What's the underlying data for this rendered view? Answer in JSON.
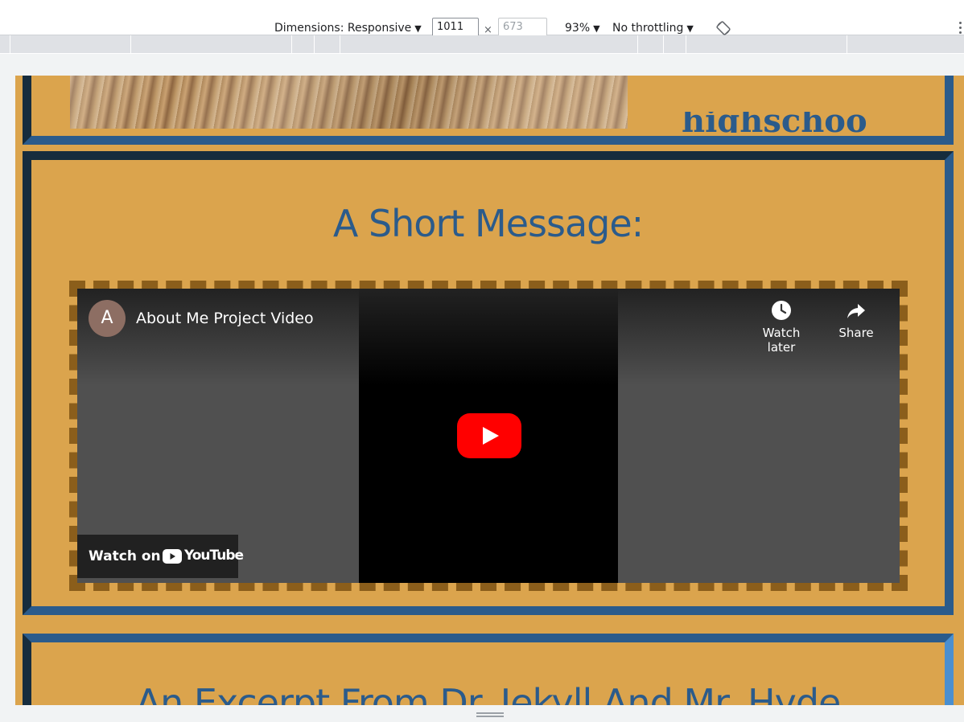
{
  "toolbar": {
    "dimensions_label": "Dimensions: Responsive",
    "width_value": "1011",
    "times": "×",
    "height_placeholder": "673",
    "zoom": "93%",
    "throttling": "No throttling",
    "dropdown_glyph": "▼",
    "rotate_icon": "rotate-icon",
    "more_icon": "more-vert-icon"
  },
  "page": {
    "hero_heading": "highschool",
    "message_title": "A Short Message:",
    "excerpt_title": "An Excerpt From Dr. Jekyll And Mr. Hyde"
  },
  "video": {
    "channel_initial": "A",
    "title": "About Me Project Video",
    "watch_later": "Watch later",
    "share": "Share",
    "watch_on": "Watch on",
    "youtube": "YouTube"
  },
  "colors": {
    "page_bg": "#dba44d",
    "heading": "#2b5b8b",
    "border_dark": "#162c3d",
    "border_blue": "#2b5b8b",
    "frame_dash": "#8b5e1b",
    "youtube_red": "#ff0000"
  }
}
